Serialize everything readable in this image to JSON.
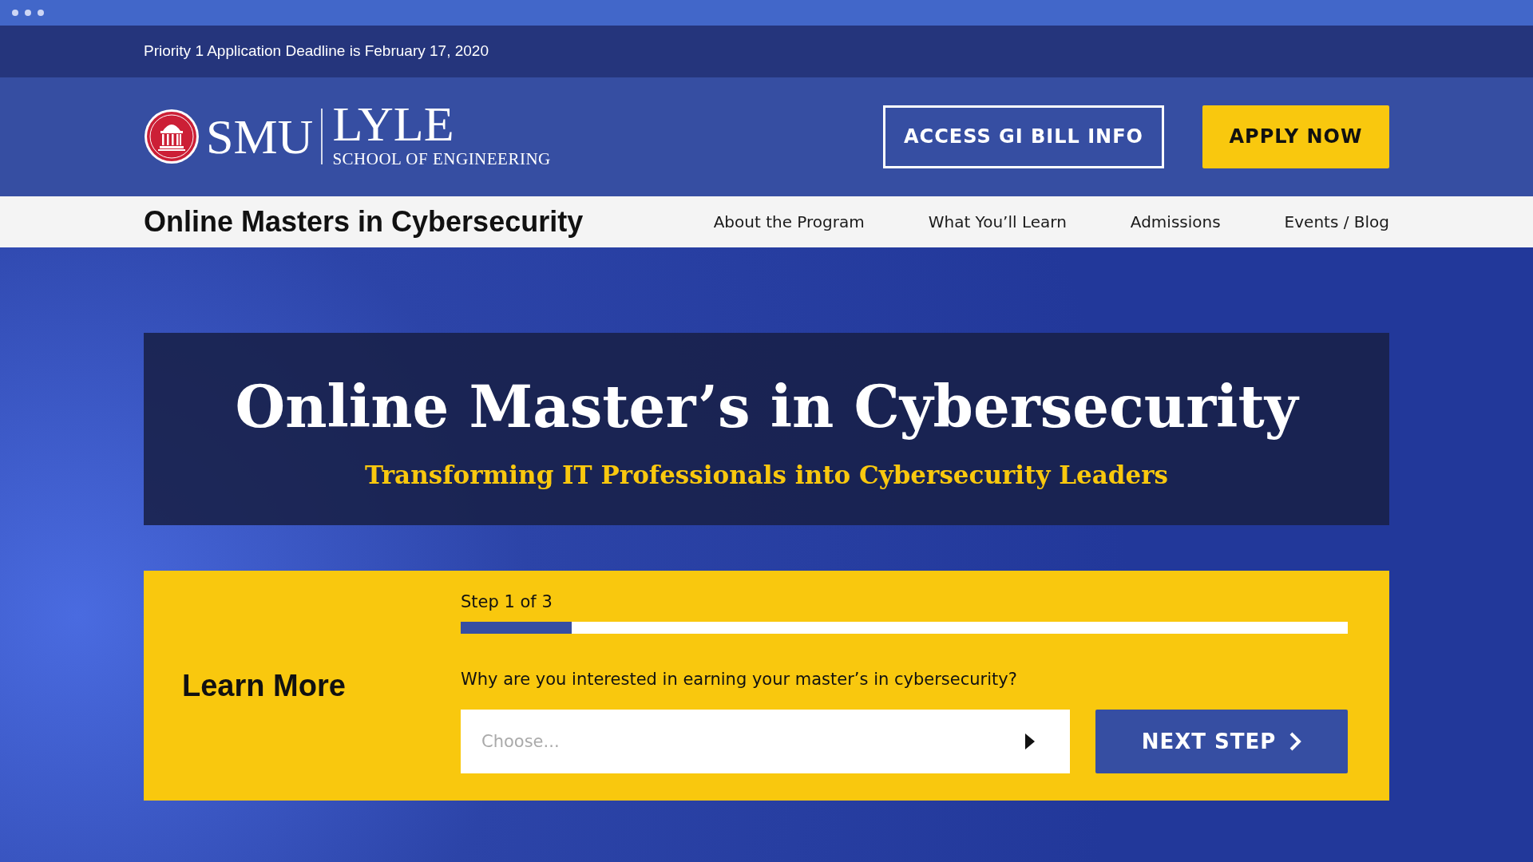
{
  "announcement": "Priority 1 Application Deadline is February 17, 2020",
  "logo": {
    "wordmark": "SMU",
    "school": "LYLE",
    "subtitle": "SCHOOL OF ENGINEERING"
  },
  "header_buttons": [
    {
      "label": "ACCESS GI BILL INFO",
      "kind": "outline"
    },
    {
      "label": "APPLY NOW",
      "kind": "solid"
    }
  ],
  "program_title": "Online Masters in Cybersecurity",
  "nav": [
    "About the Program",
    "What You’ll Learn",
    "Admissions",
    "Events / Blog"
  ],
  "hero": {
    "title": "Online Master’s in Cybersecurity",
    "subtitle": "Transforming IT Professionals into Cybersecurity Leaders"
  },
  "form": {
    "heading": "Learn More",
    "step": "Step 1 of 3",
    "progress": {
      "level": 0.125
    },
    "question": "Why are you interested in earning your master’s in cybersecurity?",
    "select": {
      "placeholder": "Choose..."
    },
    "button": "NEXT STEP"
  }
}
